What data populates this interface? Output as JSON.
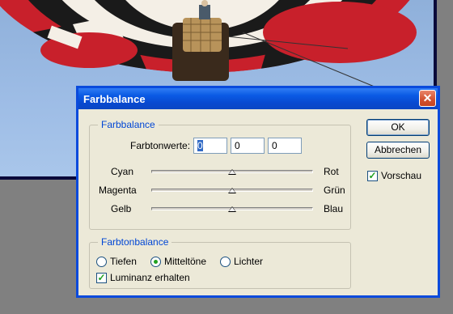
{
  "dialog": {
    "title": "Farbbalance",
    "close_icon": "close-icon",
    "color_balance": {
      "legend": "Farbbalance",
      "tone_values_label": "Farbtonwerte:",
      "values": [
        "0",
        "0",
        "0"
      ],
      "sliders": [
        {
          "left": "Cyan",
          "right": "Rot",
          "value": 0
        },
        {
          "left": "Magenta",
          "right": "Grün",
          "value": 0
        },
        {
          "left": "Gelb",
          "right": "Blau",
          "value": 0
        }
      ]
    },
    "tone_balance": {
      "legend": "Farbtonbalance",
      "options": [
        "Tiefen",
        "Mitteltöne",
        "Lichter"
      ],
      "selected": "Mitteltöne",
      "preserve_luminosity_label": "Luminanz erhalten",
      "preserve_luminosity": true
    },
    "buttons": {
      "ok": "OK",
      "cancel": "Abbrechen"
    },
    "preview_label": "Vorschau",
    "preview": true
  },
  "colors": {
    "titlebar": "#0a5ae4",
    "accent": "#0046d5",
    "dialog_bg": "#ece9d8"
  }
}
